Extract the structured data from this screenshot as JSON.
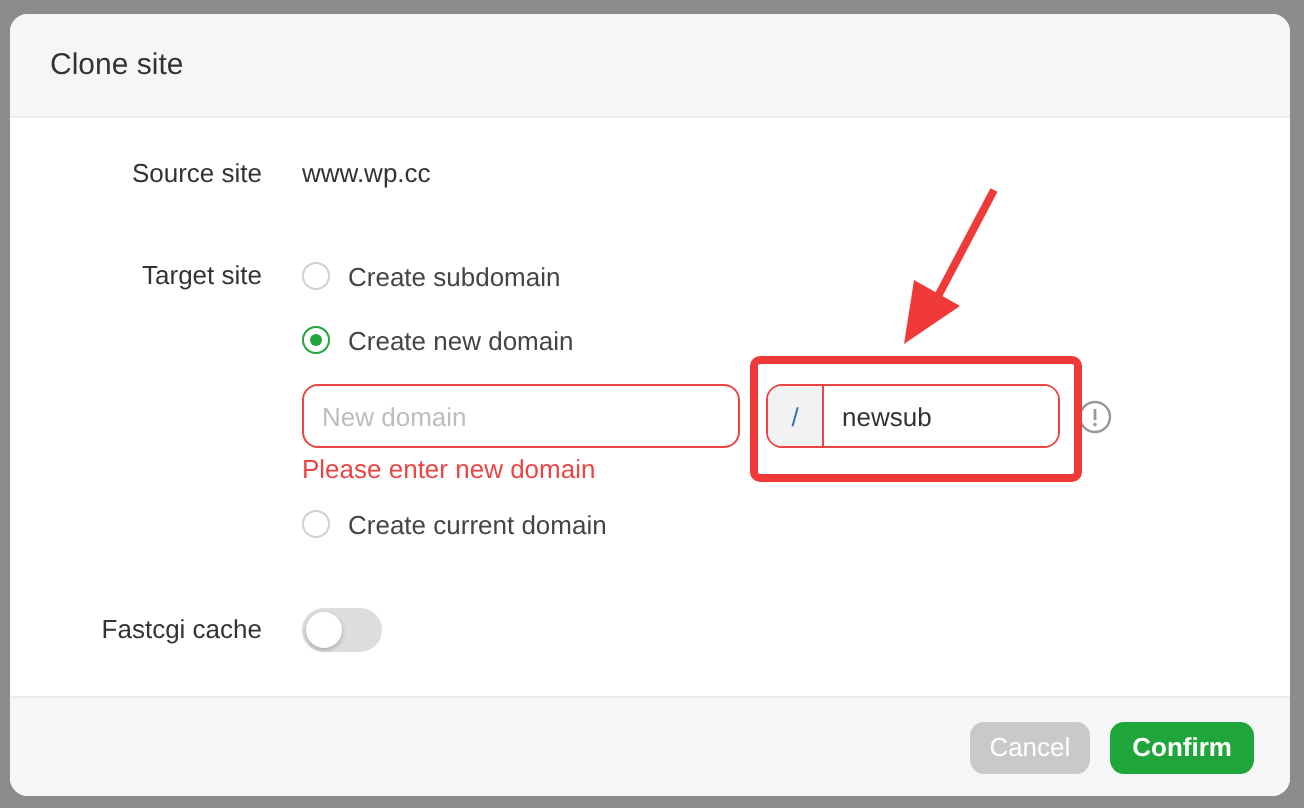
{
  "dialog": {
    "title": "Clone site"
  },
  "source_site": {
    "label": "Source site",
    "value": "www.wp.cc"
  },
  "target_site": {
    "label": "Target site",
    "options": [
      {
        "label": "Create subdomain",
        "selected": false
      },
      {
        "label": "Create new domain",
        "selected": true
      },
      {
        "label": "Create current domain",
        "selected": false
      }
    ],
    "new_domain": {
      "placeholder": "New domain",
      "error": "Please enter new domain"
    },
    "subdomain": {
      "prefix": "/",
      "value": "newsub"
    }
  },
  "fastcgi_cache": {
    "label": "Fastcgi cache",
    "on": false
  },
  "buttons": [
    {
      "label": "Cancel",
      "kind": "secondary",
      "disabled": true
    },
    {
      "label": "Confirm",
      "kind": "primary",
      "disabled": false
    }
  ]
}
